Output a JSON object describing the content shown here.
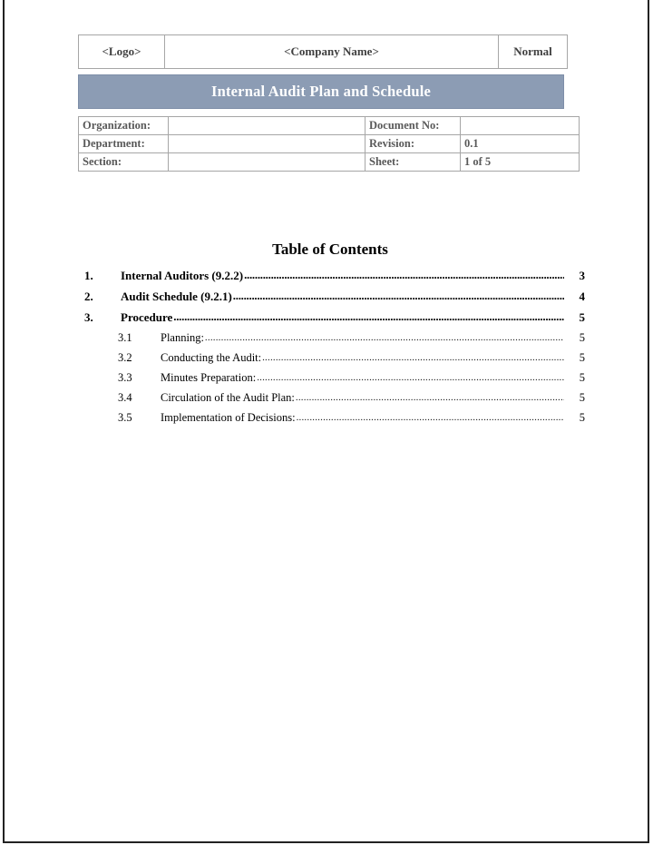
{
  "header": {
    "logo_cell": "<Logo>",
    "company_cell": "<Company Name>",
    "status_cell": "Normal"
  },
  "banner": {
    "title": "Internal Audit Plan and Schedule",
    "background_color": "#8c9cb4",
    "text_color": "#ffffff"
  },
  "metadata": {
    "rows": [
      {
        "left_label": "Organization:",
        "left_value": "",
        "right_label": "Document No:",
        "right_value": ""
      },
      {
        "left_label": "Department:",
        "left_value": "",
        "right_label": "Revision:",
        "right_value": "0.1"
      },
      {
        "left_label": "Section:",
        "left_value": "",
        "right_label": "Sheet:",
        "right_value": "1 of 5"
      }
    ]
  },
  "toc": {
    "heading": "Table of Contents",
    "entries": [
      {
        "number": "1.",
        "title": "Internal Auditors (9.2.2)",
        "page": "3",
        "level": 1
      },
      {
        "number": "2.",
        "title": "Audit Schedule (9.2.1)",
        "page": "4",
        "level": 1
      },
      {
        "number": "3.",
        "title": "Procedure",
        "page": "5",
        "level": 1
      },
      {
        "number": "3.1",
        "title": "Planning:",
        "page": "5",
        "level": 2
      },
      {
        "number": "3.2",
        "title": "Conducting the Audit:",
        "page": "5",
        "level": 2
      },
      {
        "number": "3.3",
        "title": "Minutes Preparation:",
        "page": "5",
        "level": 2
      },
      {
        "number": "3.4",
        "title": "Circulation of the Audit Plan:",
        "page": "5",
        "level": 2
      },
      {
        "number": "3.5",
        "title": "Implementation of Decisions:",
        "page": "5",
        "level": 2
      }
    ],
    "leader_char": "."
  }
}
